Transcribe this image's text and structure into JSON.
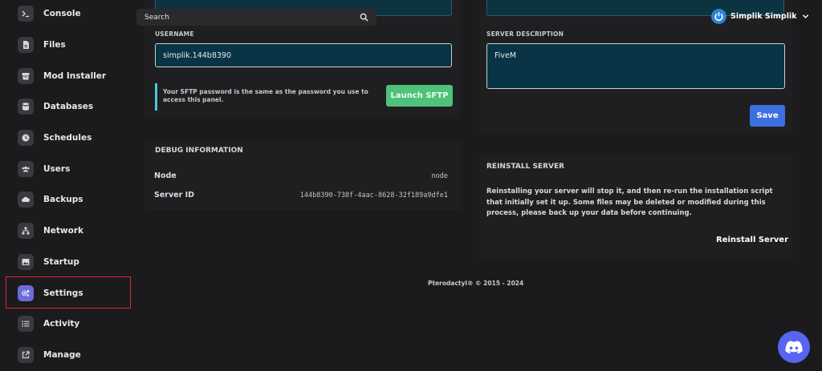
{
  "search": {
    "placeholder": "Search"
  },
  "user": {
    "name": "Simplik Simplik"
  },
  "sidebar": {
    "items": [
      {
        "label": "Console",
        "icon": "terminal-icon"
      },
      {
        "label": "Files",
        "icon": "file-icon"
      },
      {
        "label": "Mod Installer",
        "icon": "box-icon"
      },
      {
        "label": "Databases",
        "icon": "database-icon"
      },
      {
        "label": "Schedules",
        "icon": "clock-icon"
      },
      {
        "label": "Users",
        "icon": "users-icon"
      },
      {
        "label": "Backups",
        "icon": "cloud-icon"
      },
      {
        "label": "Network",
        "icon": "network-icon"
      },
      {
        "label": "Startup",
        "icon": "image-icon"
      },
      {
        "label": "Settings",
        "icon": "cogs-icon",
        "active": true
      },
      {
        "label": "Activity",
        "icon": "list-icon"
      },
      {
        "label": "Manage",
        "icon": "external-link-icon"
      }
    ]
  },
  "sftp": {
    "username_label": "USERNAME",
    "username_value": "simplik.144b8390",
    "hint": "Your SFTP password is the same as the password you use to access this panel.",
    "launch_label": "Launch SFTP"
  },
  "server_details": {
    "description_label": "SERVER DESCRIPTION",
    "description_value": "FiveM",
    "save_label": "Save"
  },
  "debug": {
    "title": "DEBUG INFORMATION",
    "node_label": "Node",
    "node_value": "node",
    "server_id_label": "Server ID",
    "server_id_value": "144b8390-738f-4aac-8628-32f189a9dfe1"
  },
  "reinstall": {
    "title": "REINSTALL SERVER",
    "description": "Reinstalling your server will stop it, and then re-run the installation script that initially set it up. Some files may be deleted or modified during this process, please back up your data before continuing.",
    "button_label": "Reinstall Server"
  },
  "footer": {
    "text": "Pterodactyl® © 2015 - 2024"
  },
  "colors": {
    "accent": "#6d6bdc",
    "sftp_button": "#4fc17a",
    "save_button": "#3d6fe0",
    "highlight_border": "#e0262c",
    "discord": "#5865f2"
  }
}
